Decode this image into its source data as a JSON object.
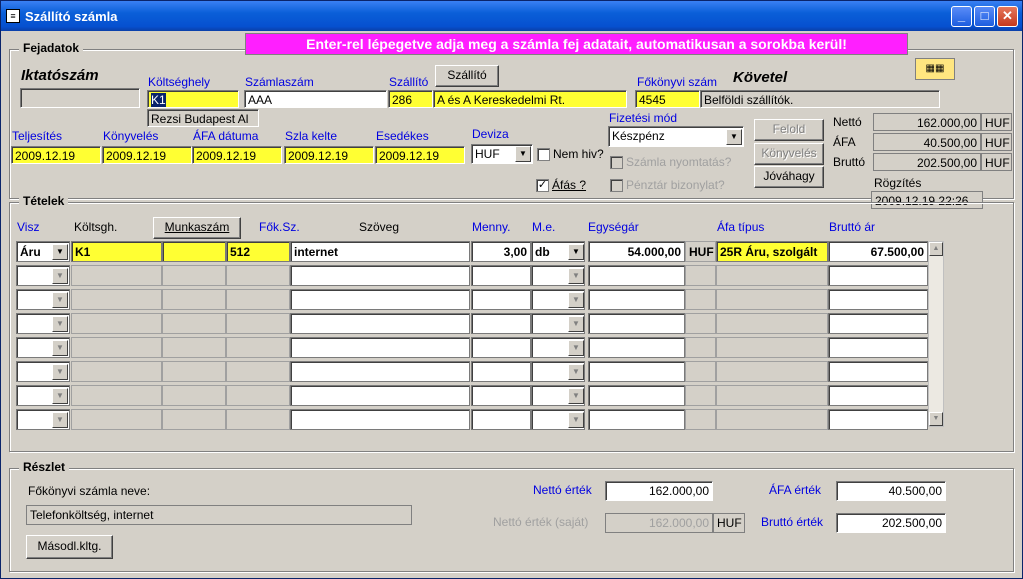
{
  "window": {
    "title": "Szállító számla",
    "icon": "app-icon"
  },
  "banner": "Enter-rel lépegetve adja meg a számla fej adatait, automatikusan a sorokba kerül!",
  "header_section": {
    "title": "Fejadatok",
    "iktatoszam_label": "Iktatószám",
    "iktatoszam_value": "",
    "koltseghely_label": "Költséghely",
    "koltseghely_value": "K1",
    "koltseghely_desc": "Rezsi Budapest Al",
    "szamlaszam_label": "Számlaszám",
    "szamlaszam_value": "AAA",
    "szallito_label": "Szállító",
    "szallito_button": "Szállító",
    "szallito_code": "286",
    "szallito_name": "A és A Kereskedelmi Rt.",
    "fokonyvi_label": "Főkönyvi szám",
    "fokonyvi_value": "4545",
    "fokonyvi_desc": "Belföldi szállítók.",
    "kovetel_label": "Követel",
    "teljesites_label": "Teljesítés",
    "teljesites_value": "2009.12.19",
    "konyveles_label": "Könyvelés",
    "konyveles_value": "2009.12.19",
    "afa_datum_label": "ÁFA dátuma",
    "afa_datum_value": "2009.12.19",
    "szla_kelte_label": "Szla kelte",
    "szla_kelte_value": "2009.12.19",
    "esedekes_label": "Esedékes",
    "esedekes_value": "2009.12.19",
    "deviza_label": "Deviza",
    "deviza_value": "HUF",
    "nem_hiv_label": "Nem hiv?",
    "afas_label": "Áfás ?",
    "fizetesi_mod_label": "Fizetési mód",
    "fizetesi_mod_value": "Készpénz",
    "szamla_nyomtatas_label": "Számla nyomtatás?",
    "penztar_bizonylat_label": "Pénztár bizonylat?",
    "feloldas_button": "Felold",
    "konyveles_button": "Könyvelés",
    "jovahagy_button": "Jóváhagy",
    "netto_label": "Nettó",
    "netto_value": "162.000,00",
    "afa_label": "ÁFA",
    "afa_value": "40.500,00",
    "brutto_label": "Bruttó",
    "brutto_value": "202.500,00",
    "currency": "HUF",
    "rogzites_label": "Rögzítés",
    "rogzites_value": "2009.12.19 22:26"
  },
  "items_section": {
    "title": "Tételek",
    "columns": {
      "visz": "Visz",
      "koltsgh": "Költsgh.",
      "munkaszam_button": "Munkaszám",
      "fok_sz": "Fők.Sz.",
      "szoveg": "Szöveg",
      "menny": "Menny.",
      "me": "M.e.",
      "egysegar": "Egységár",
      "afa_tipus": "Áfa típus",
      "brutto_ar": "Bruttó ár"
    },
    "row1": {
      "visz": "Áru",
      "koltsgh": "K1",
      "munkaszam": "",
      "fok_sz": "512",
      "szoveg": "internet",
      "menny": "3,00",
      "me": "db",
      "egysegar": "54.000,00",
      "currency": "HUF",
      "afa_tipus": "25R Áru, szolgált",
      "brutto_ar": "67.500,00"
    }
  },
  "detail_section": {
    "title": "Részlet",
    "fokonyvi_nev_label": "Főkönyvi számla neve:",
    "fokonyvi_nev_value": "Telefonköltség, internet",
    "masodl_button": "Másodl.kltg.",
    "netto_ertek_label": "Nettó érték",
    "netto_ertek_value": "162.000,00",
    "netto_sajat_label": "Nettó érték (saját)",
    "netto_sajat_value": "162.000,00",
    "netto_sajat_currency": "HUF",
    "afa_ertek_label": "ÁFA érték",
    "afa_ertek_value": "40.500,00",
    "brutto_ertek_label": "Bruttó érték",
    "brutto_ertek_value": "202.500,00"
  }
}
